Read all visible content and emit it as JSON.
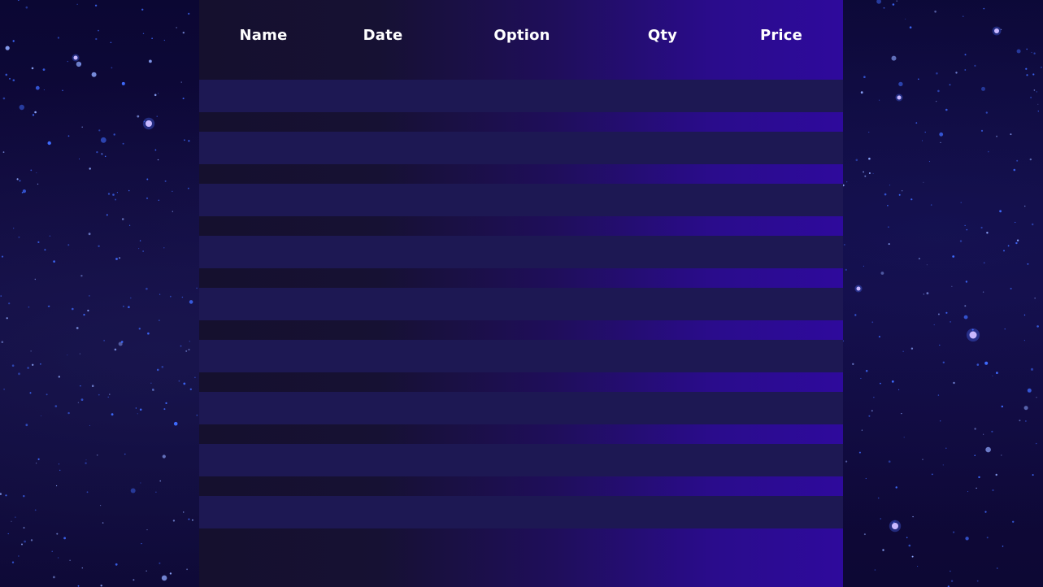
{
  "table": {
    "columns": [
      "Name",
      "Date",
      "Option",
      "Qty",
      "Price"
    ],
    "rows": [
      [
        "",
        "",
        "",
        "",
        ""
      ],
      [
        "",
        "",
        "",
        "",
        ""
      ],
      [
        "",
        "",
        "",
        "",
        ""
      ],
      [
        "",
        "",
        "",
        "",
        ""
      ],
      [
        "",
        "",
        "",
        "",
        ""
      ],
      [
        "",
        "",
        "",
        "",
        ""
      ],
      [
        "",
        "",
        "",
        "",
        ""
      ],
      [
        "",
        "",
        "",
        "",
        ""
      ],
      [
        "",
        "",
        "",
        "",
        ""
      ]
    ]
  },
  "colors": {
    "background": "#0d0830",
    "panel_left": "#15102e",
    "panel_right": "#2e0a9c",
    "row_fill": "#1d1853",
    "header_text": "#ffffff"
  }
}
